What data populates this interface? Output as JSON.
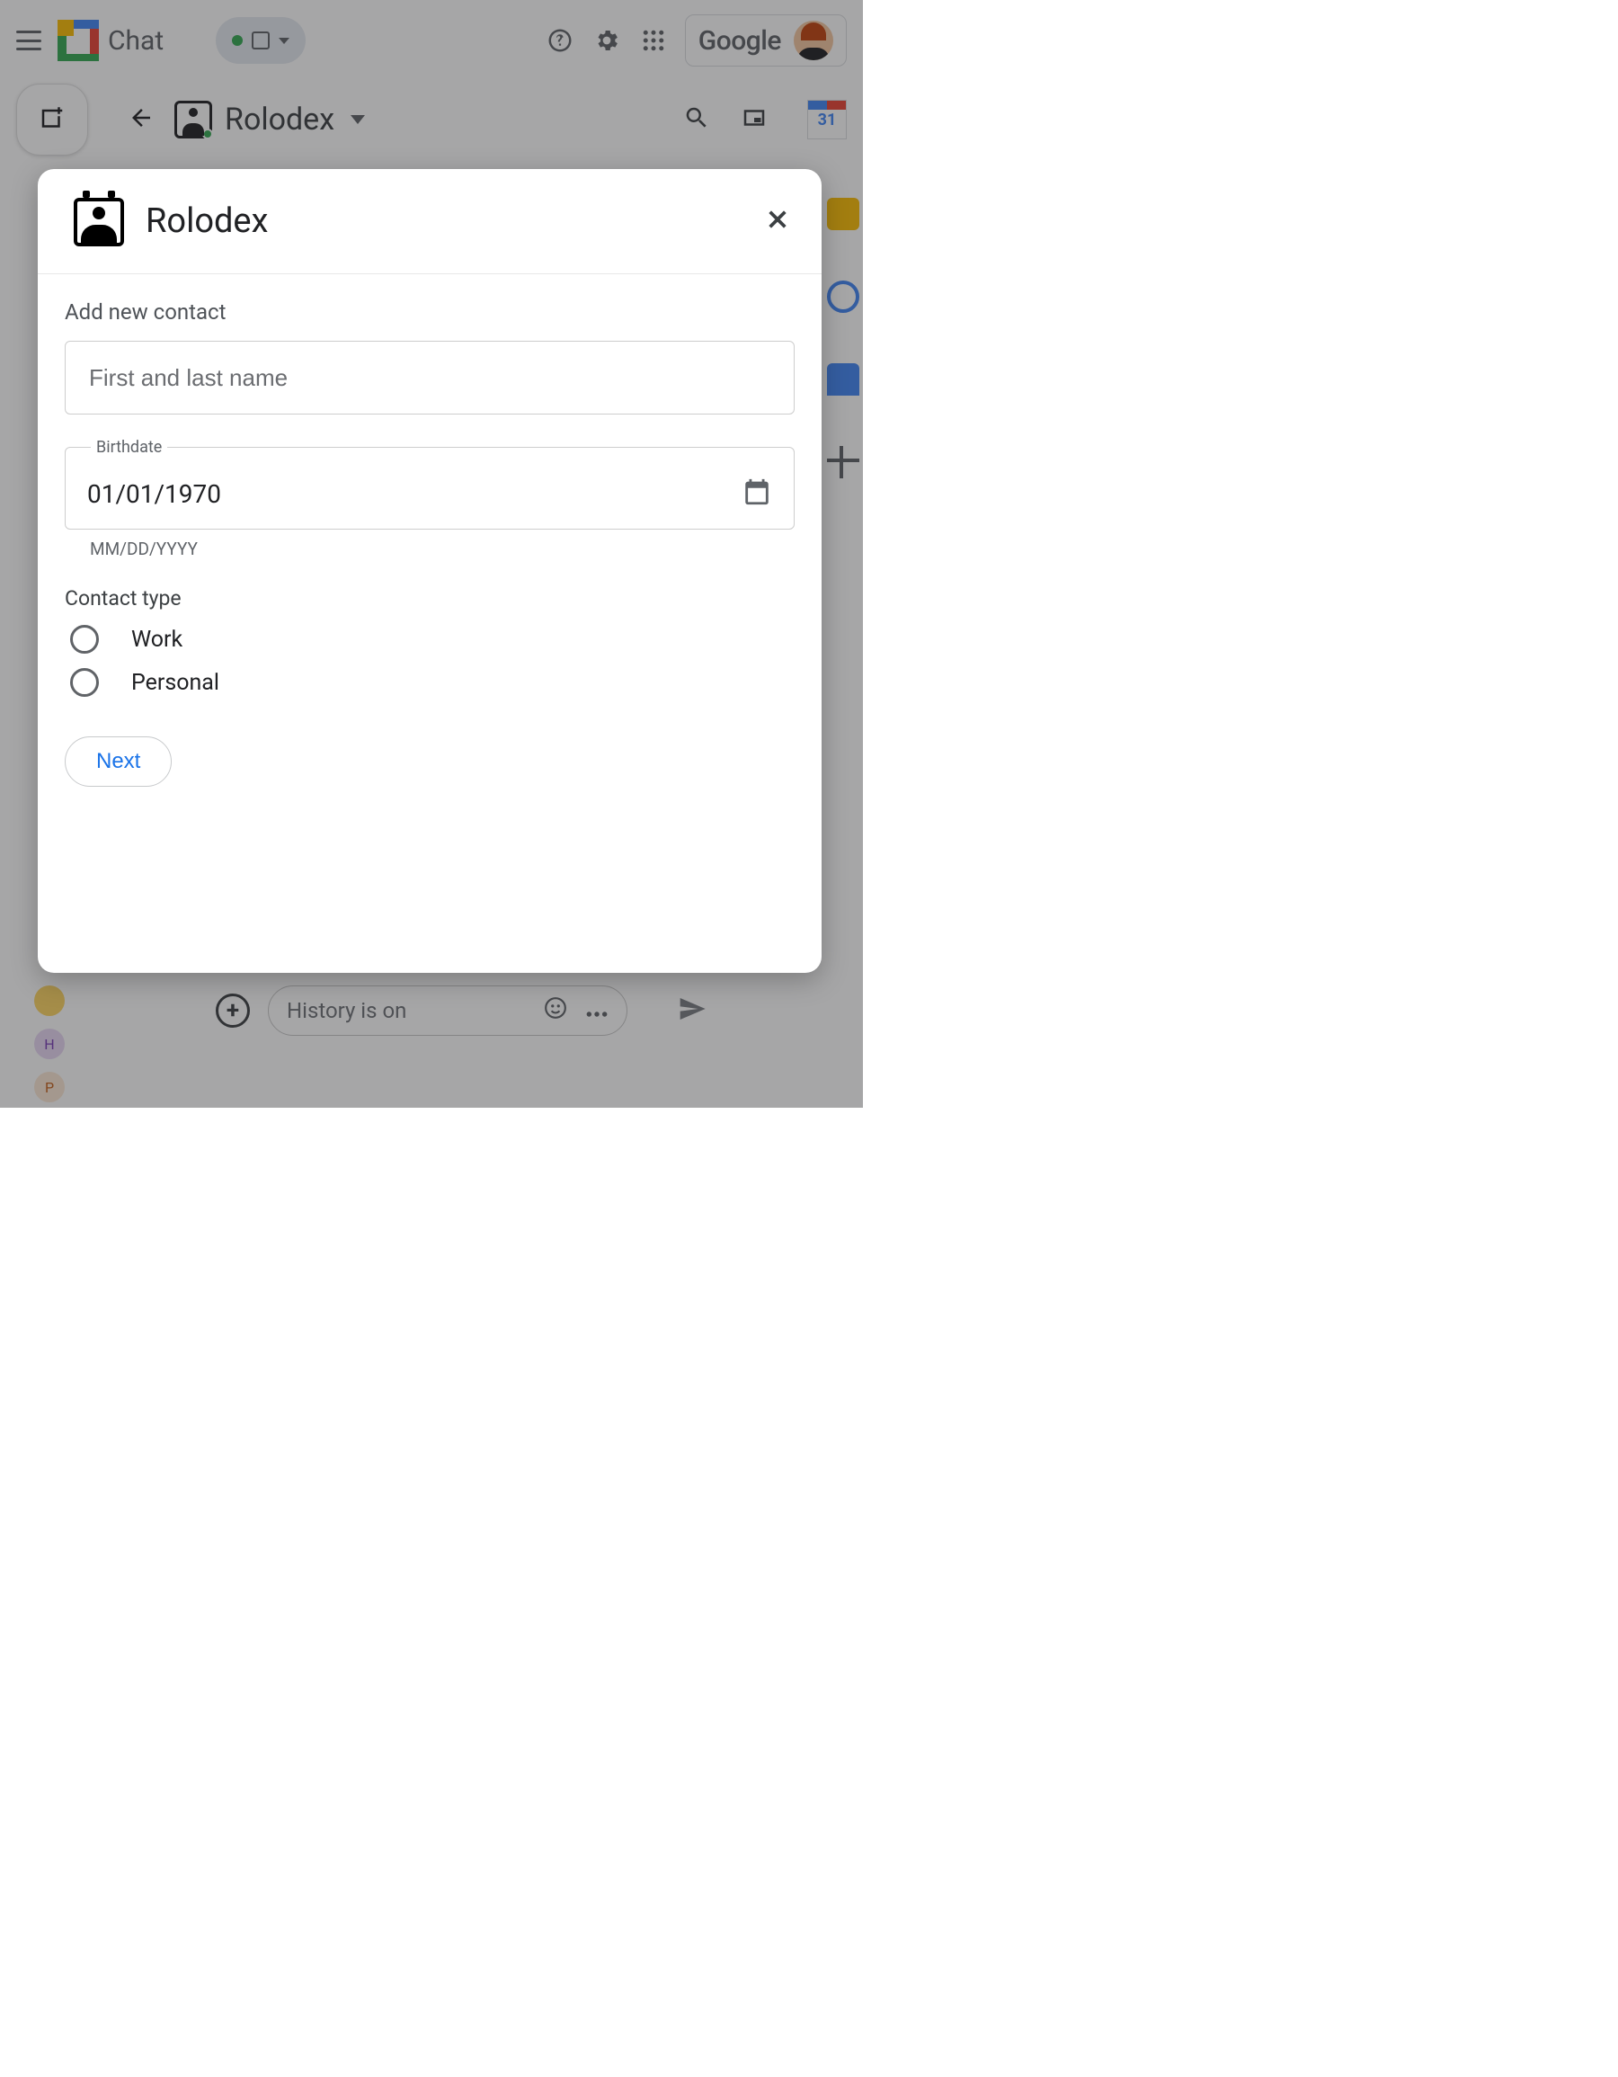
{
  "topbar": {
    "app_name": "Chat",
    "google_label": "Google"
  },
  "secbar": {
    "title": "Rolodex",
    "calendar_day": "31"
  },
  "modal": {
    "title": "Rolodex",
    "section_heading": "Add new contact",
    "name_placeholder": "First and last name",
    "birthdate_label": "Birthdate",
    "birthdate_value": "01/01/1970",
    "birthdate_hint": "MM/DD/YYYY",
    "contact_type_label": "Contact type",
    "radio_work": "Work",
    "radio_personal": "Personal",
    "next_label": "Next"
  },
  "compose": {
    "placeholder": "History is on"
  },
  "avatars": {
    "h": "H",
    "p": "P"
  }
}
